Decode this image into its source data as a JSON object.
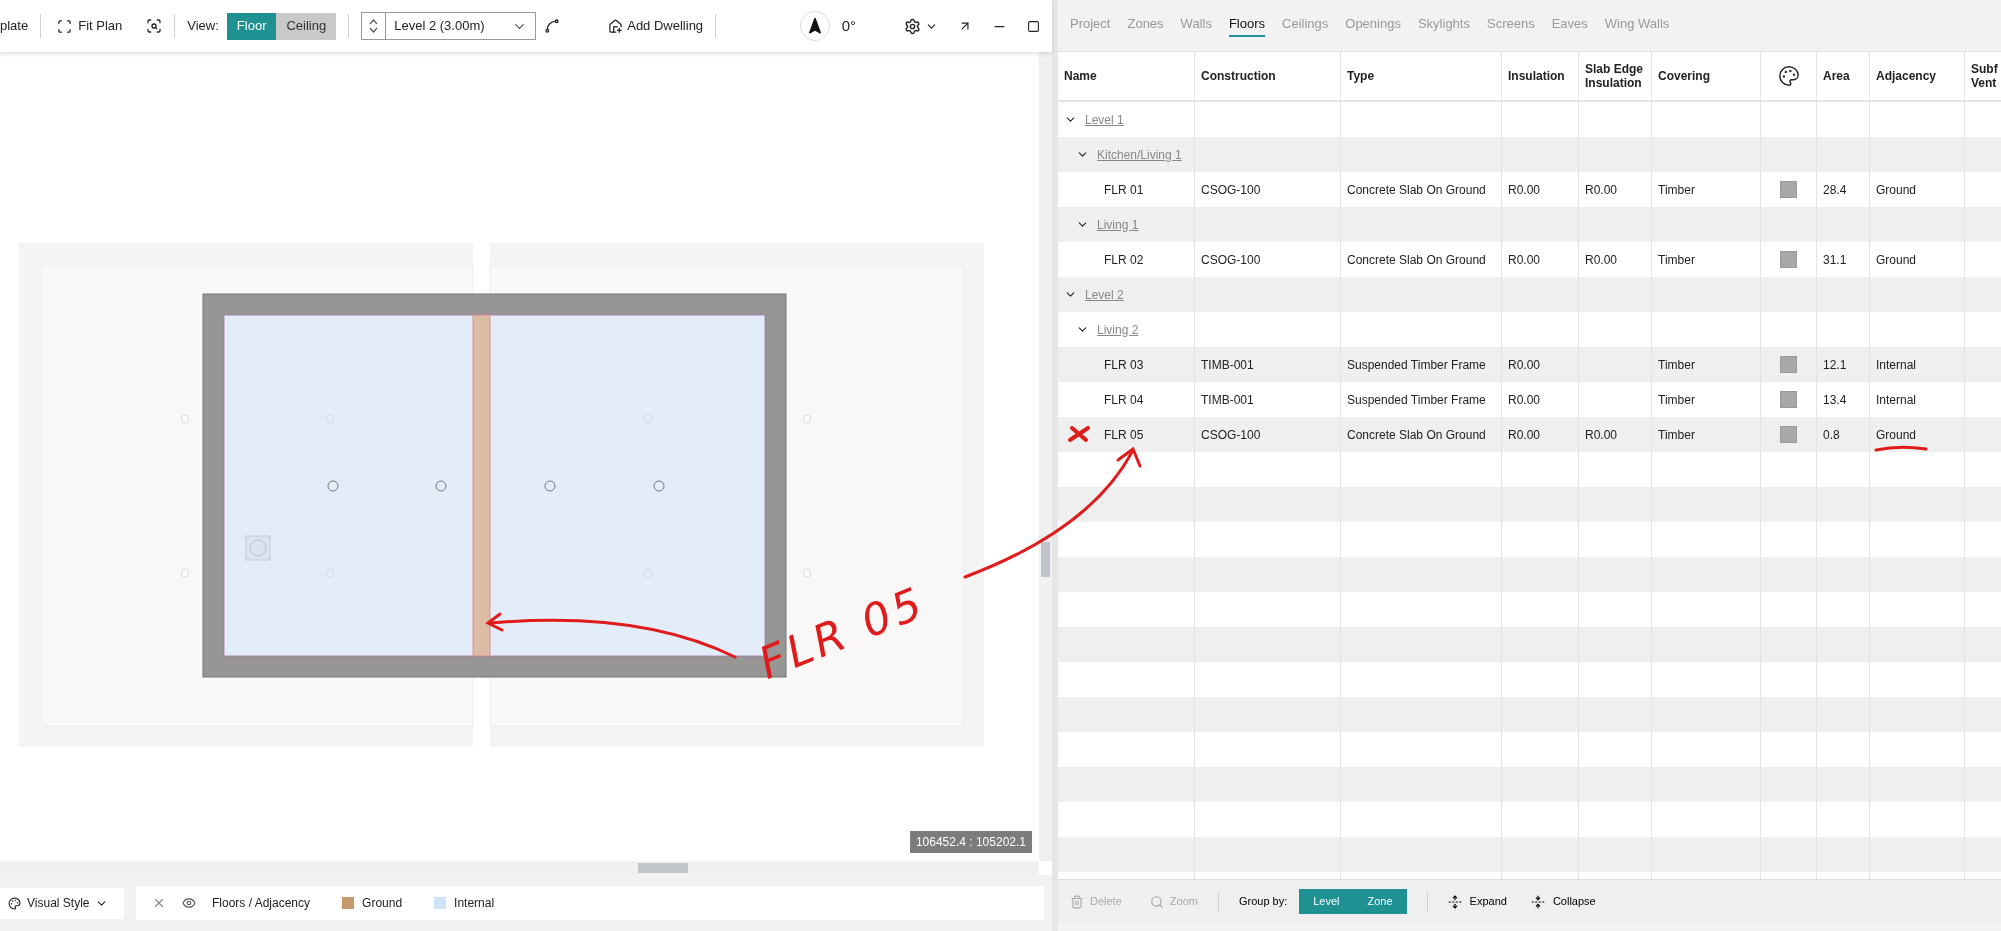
{
  "toolbar": {
    "cut_label": "plate",
    "fit_plan": "Fit Plan",
    "view_label": "View:",
    "view_options": [
      {
        "label": "Floor",
        "selected": true
      },
      {
        "label": "Ceiling",
        "selected": false
      }
    ],
    "level_select": "Level 2 (3.00m)",
    "add_dwelling": "Add Dwelling",
    "rotation": "0°"
  },
  "plan": {
    "coordinates": "106452.4 : 105202.1"
  },
  "annotation": {
    "text": "FLR 05"
  },
  "visual_style": {
    "label": "Visual Style",
    "layer": "Floors / Adjacency",
    "legend": [
      {
        "label": "Ground",
        "color": "#c4996c"
      },
      {
        "label": "Internal",
        "color": "#cfe3f8"
      }
    ]
  },
  "tabs": [
    {
      "label": "Project",
      "selected": false
    },
    {
      "label": "Zones",
      "selected": false
    },
    {
      "label": "Walls",
      "selected": false
    },
    {
      "label": "Floors",
      "selected": true
    },
    {
      "label": "Ceilings",
      "selected": false
    },
    {
      "label": "Openings",
      "selected": false
    },
    {
      "label": "Skylights",
      "selected": false
    },
    {
      "label": "Screens",
      "selected": false
    },
    {
      "label": "Eaves",
      "selected": false
    },
    {
      "label": "Wing Walls",
      "selected": false
    }
  ],
  "table": {
    "columns": [
      {
        "kind": "text",
        "label": "Name"
      },
      {
        "kind": "text",
        "label": "Construction"
      },
      {
        "kind": "text",
        "label": "Type"
      },
      {
        "kind": "text",
        "label": "Insulation"
      },
      {
        "kind": "text",
        "label": "Slab Edge Insulation"
      },
      {
        "kind": "text",
        "label": "Covering"
      },
      {
        "kind": "icon"
      },
      {
        "kind": "text",
        "label": "Area"
      },
      {
        "kind": "text",
        "label": "Adjacency"
      },
      {
        "kind": "text",
        "label": "Subf Vent"
      }
    ],
    "rows": [
      {
        "kind": "group",
        "name": "Level 1",
        "expanded": true,
        "children": [
          {
            "kind": "group",
            "name": "Kitchen/Living 1",
            "expanded": true,
            "children": [
              {
                "kind": "floor",
                "name": "FLR 01",
                "construction": "CSOG-100",
                "type": "Concrete Slab On Ground",
                "insulation": "R0.00",
                "slab_edge_insulation": "R0.00",
                "covering": "Timber",
                "area": "28.4",
                "adjacency": "Ground"
              }
            ]
          },
          {
            "kind": "group",
            "name": "Living 1",
            "expanded": true,
            "children": [
              {
                "kind": "floor",
                "name": "FLR 02",
                "construction": "CSOG-100",
                "type": "Concrete Slab On Ground",
                "insulation": "R0.00",
                "slab_edge_insulation": "R0.00",
                "covering": "Timber",
                "area": "31.1",
                "adjacency": "Ground"
              }
            ]
          }
        ]
      },
      {
        "kind": "group",
        "name": "Level 2",
        "expanded": true,
        "children": [
          {
            "kind": "group",
            "name": "Living 2",
            "expanded": true,
            "children": [
              {
                "kind": "floor",
                "name": "FLR 03",
                "construction": "TIMB-001",
                "type": "Suspended Timber Frame",
                "insulation": "R0.00",
                "covering": "Timber",
                "area": "12.1",
                "adjacency": "Internal"
              },
              {
                "kind": "floor",
                "name": "FLR 04",
                "construction": "TIMB-001",
                "type": "Suspended Timber Frame",
                "insulation": "R0.00",
                "covering": "Timber",
                "area": "13.4",
                "adjacency": "Internal"
              },
              {
                "kind": "floor",
                "name": "FLR 05",
                "construction": "CSOG-100",
                "type": "Concrete Slab On Ground",
                "insulation": "R0.00",
                "slab_edge_insulation": "R0.00",
                "covering": "Timber",
                "area": "0.8",
                "adjacency": "Ground"
              }
            ]
          }
        ]
      }
    ]
  },
  "footer": {
    "delete": {
      "label": "Delete",
      "disabled": true
    },
    "zoom": {
      "label": "Zoom",
      "disabled": true
    },
    "group_by_label": "Group by:",
    "group_by": [
      {
        "label": "Level",
        "selected": true
      },
      {
        "label": "Zone",
        "selected": true
      }
    ],
    "expand": "Expand",
    "collapse": "Collapse"
  }
}
